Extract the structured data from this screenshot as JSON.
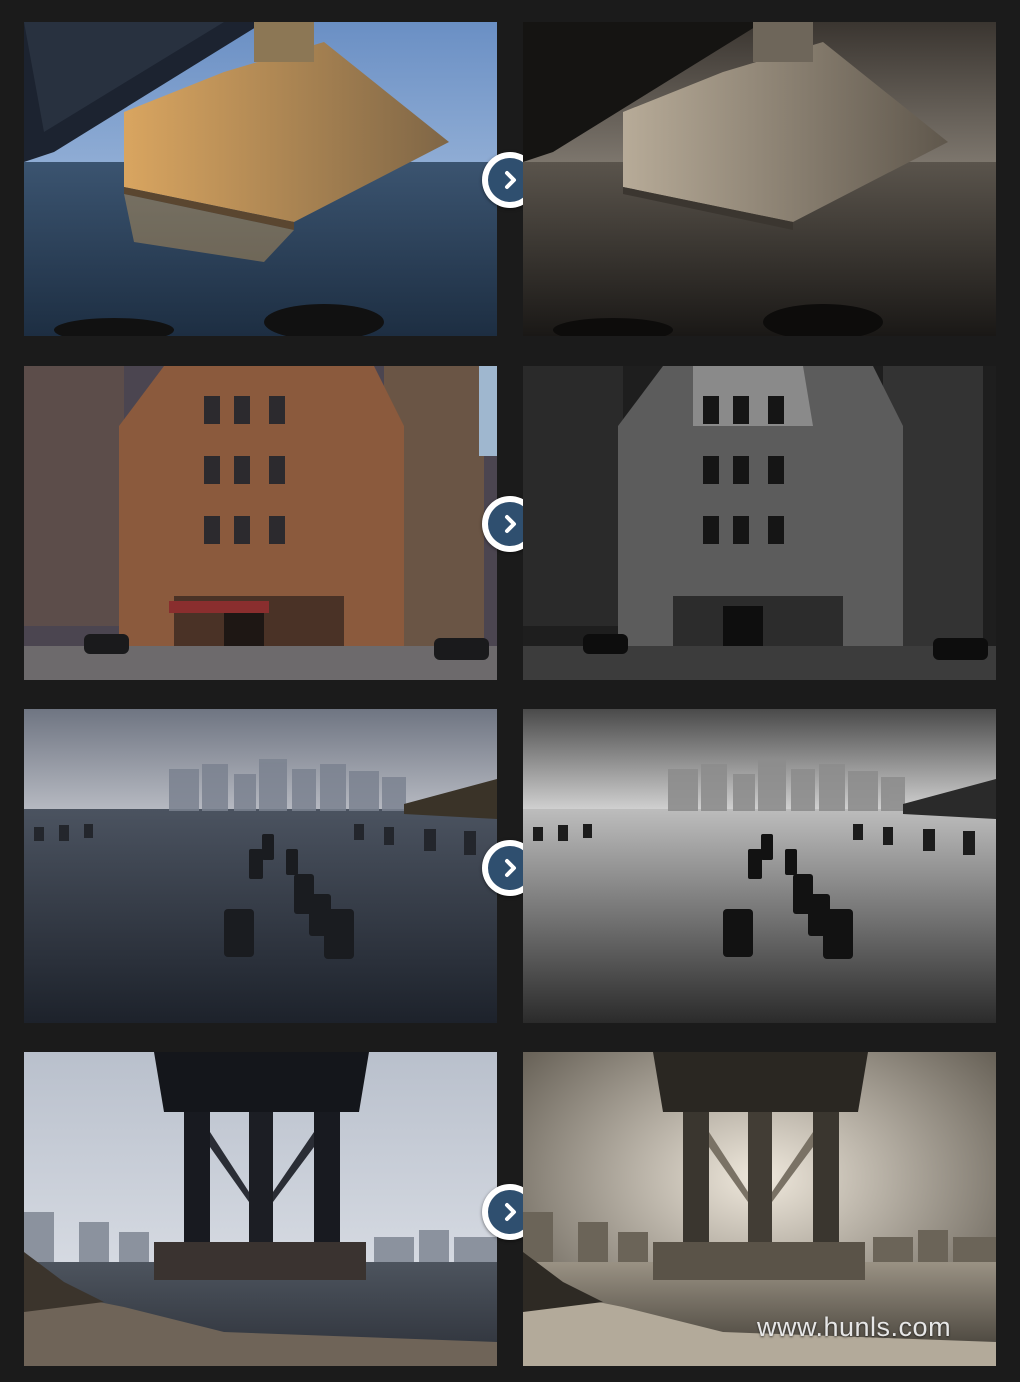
{
  "watermark": "www.hunls.com",
  "rows": [
    {
      "before": "bridge-pier-color-photo",
      "after": "bridge-pier-bw-photo",
      "button": "next-arrow-icon"
    },
    {
      "before": "delmonicos-building-color-photo",
      "after": "delmonicos-building-bw-photo",
      "button": "next-arrow-icon"
    },
    {
      "before": "pier-pilings-color-photo",
      "after": "pier-pilings-bw-photo",
      "button": "next-arrow-icon"
    },
    {
      "before": "bridge-tower-color-photo",
      "after": "bridge-tower-bw-photo",
      "button": "next-arrow-icon"
    }
  ],
  "colors": {
    "background": "#1b1b1b",
    "button_fill": "#2f4f6f",
    "button_ring": "#ffffff"
  }
}
